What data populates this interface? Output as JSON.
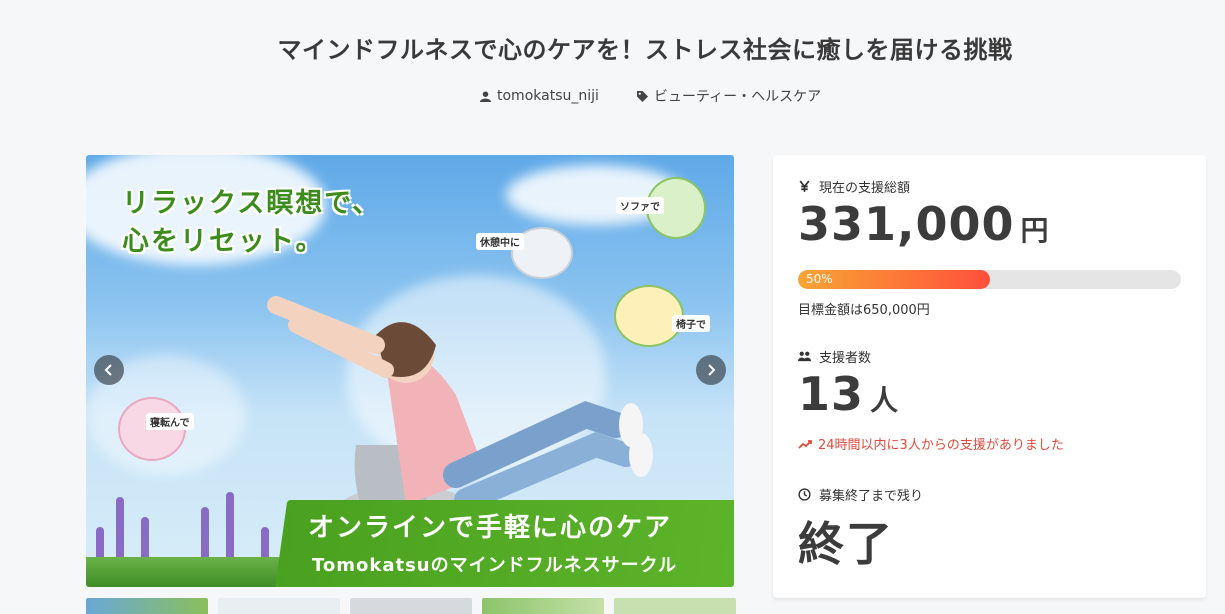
{
  "project": {
    "title": "マインドフルネスで心のケアを！ストレス社会に癒しを届ける挑戦",
    "author": "tomokatsu_niji",
    "category": "ビューティー・ヘルスケア"
  },
  "hero": {
    "headline_line1": "リラックス瞑想で、",
    "headline_line2": "心をリセット。",
    "bubble_sofa": "ソファで",
    "bubble_break": "休憩中に",
    "bubble_chair": "椅子で",
    "bubble_lying": "寝転んで",
    "banner_line1": "オンラインで手軽に心のケア",
    "banner_line2": "Tomokatsuのマインドフルネスサークル"
  },
  "funding": {
    "total_label": "現在の支援総額",
    "total_amount": "331,000",
    "currency_unit": "円",
    "progress_percent": 50,
    "progress_text": "50%",
    "goal_text": "目標金額は650,000円",
    "supporters_label": "支援者数",
    "supporters_count": "13",
    "supporters_unit": "人",
    "recent_text": "24時間以内に3人からの支援がありました",
    "deadline_label": "募集終了まで残り",
    "deadline_value": "終了"
  },
  "colors": {
    "accent_red": "#e34a3b",
    "progress_start": "#f9a534",
    "progress_end": "#ff4f3c",
    "banner_green": "#4aa11f"
  }
}
